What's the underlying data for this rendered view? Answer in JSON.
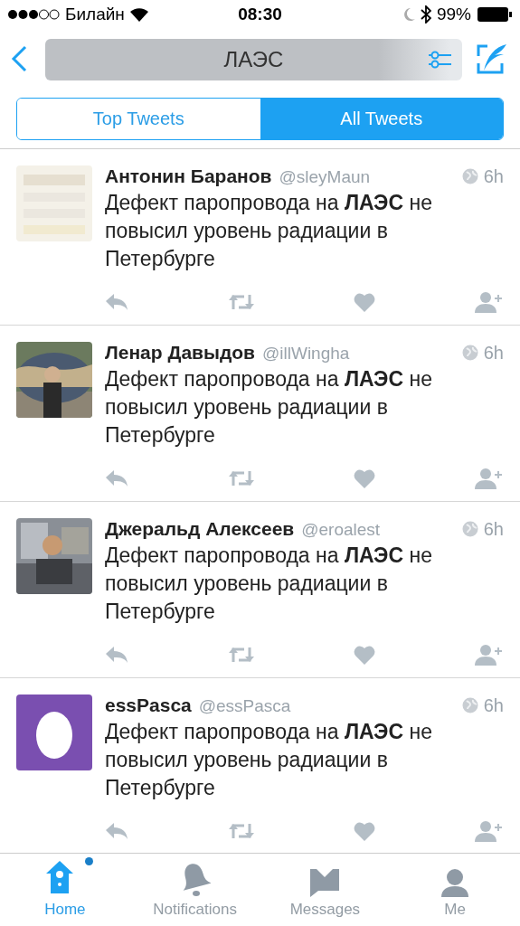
{
  "status_bar": {
    "carrier": "Билайн",
    "time": "08:30",
    "battery": "99%"
  },
  "search": {
    "value": "ЛАЭС"
  },
  "tabs": [
    {
      "label": "Top Tweets",
      "selected": false
    },
    {
      "label": "All Tweets",
      "selected": true
    }
  ],
  "tweets": [
    {
      "name": "Антонин Баранов",
      "handle": "@sleyMaun",
      "time": "6h",
      "text": "Дефект паропровода на **ЛАЭС** не повысил уровень радиации в Петербурге"
    },
    {
      "name": "Ленар Давыдов",
      "handle": "@illWingha",
      "time": "6h",
      "text": "Дефект паропровода на **ЛАЭС** не повысил уровень радиации в Петербурге"
    },
    {
      "name": "Джеральд Алексеев",
      "handle": "@eroalest",
      "time": "6h",
      "text": "Дефект паропровода на **ЛАЭС** не повысил уровень радиации в Петербурге"
    },
    {
      "name": "essPasca",
      "handle": "@essPasca",
      "time": "6h",
      "text": "Дефект паропровода на **ЛАЭС** не повысил уровень радиации в Петербурге",
      "avatar": {
        "kind": "egg"
      }
    }
  ],
  "tab_bar": [
    {
      "label": "Home",
      "selected": true,
      "badge": true
    },
    {
      "label": "Notifications",
      "selected": false,
      "badge": false
    },
    {
      "label": "Messages",
      "selected": false,
      "badge": false
    },
    {
      "label": "Me",
      "selected": false,
      "badge": false
    }
  ]
}
